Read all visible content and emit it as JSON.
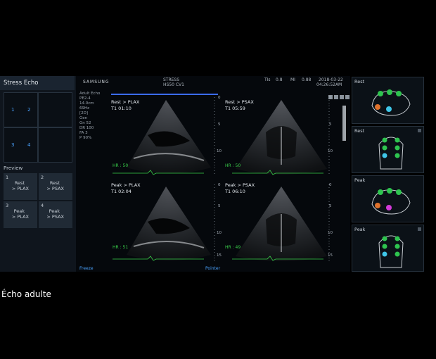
{
  "app": {
    "mode_title": "Stress Echo",
    "brand": "SAMSUNG",
    "header": {
      "stress": "STRESS",
      "model": "HS50 CV1",
      "tis_label": "TIs",
      "tis_value": "0.8",
      "mi_label": "MI",
      "mi_value": "0.88",
      "date": "2018-03-22",
      "time": "04:26:52AM"
    },
    "info": [
      "Adult Echo",
      "PE2-4",
      "14.0cm",
      "69Hz",
      "",
      "[2D]",
      "Gen",
      "Gn     52",
      "DR     100",
      "FA     3",
      "P      90%"
    ]
  },
  "layout_grid": {
    "numbers": [
      "1",
      "2",
      "3",
      "4"
    ]
  },
  "preview": {
    "label": "Preview",
    "items": [
      {
        "num": "1",
        "line1": "Rest",
        "line2": "> PLAX"
      },
      {
        "num": "2",
        "line1": "Rest",
        "line2": "> PSAX"
      },
      {
        "num": "3",
        "line1": "Peak",
        "line2": "> PLAX"
      },
      {
        "num": "4",
        "line1": "Peak",
        "line2": "> PSAX"
      }
    ]
  },
  "views": [
    {
      "label": "Rest > PLAX",
      "time": "T1 01:10",
      "hr": "HR : 50"
    },
    {
      "label": "Rest > PSAX",
      "time": "T1 05:59",
      "hr": "HR : 50"
    },
    {
      "label": "Peak > PLAX",
      "time": "T1 02:04",
      "hr": "HR : 51"
    },
    {
      "label": "Peak > PSAX",
      "time": "T1 06:10",
      "hr": "HR : 49"
    }
  ],
  "depth_scale": [
    "0",
    "5",
    "10",
    "15"
  ],
  "status": {
    "freeze": "Freeze",
    "pointer": "Pointer"
  },
  "segment_cards": [
    {
      "title": "Rest",
      "type": "psax"
    },
    {
      "title": "Rest",
      "type": "a4c"
    },
    {
      "title": "Peak",
      "type": "psax"
    },
    {
      "title": "Peak",
      "type": "a4c"
    }
  ],
  "colors": {
    "segment_green": "#2ec44f",
    "segment_orange": "#e0722c",
    "segment_magenta": "#d23ad8",
    "segment_cyan": "#3fc6e8",
    "accent_blue": "#4aa3ff",
    "hr_green": "#39d04a"
  },
  "caption": "Écho adulte"
}
